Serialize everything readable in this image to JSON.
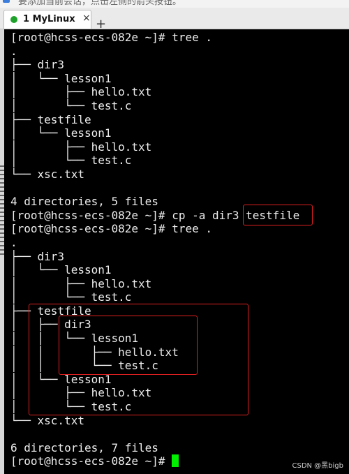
{
  "hint": {
    "text": "要添加当前会话，点击左侧的箭头按钮。"
  },
  "tabs": [
    {
      "label": "1 MyLinux",
      "close": "×",
      "status_color": "#1fa22b"
    }
  ],
  "new_tab_glyph": "+",
  "terminal": {
    "lines": [
      "[root@hcss-ecs-082e ~]# tree .",
      ".",
      "├── dir3",
      "│   └── lesson1",
      "│       ├── hello.txt",
      "│       └── test.c",
      "├── testfile",
      "│   └── lesson1",
      "│       ├── hello.txt",
      "│       └── test.c",
      "└── xsc.txt",
      "",
      "4 directories, 5 files",
      "[root@hcss-ecs-082e ~]# cp -a dir3 testfile",
      "[root@hcss-ecs-082e ~]# tree .",
      ".",
      "├── dir3",
      "│   └── lesson1",
      "│       ├── hello.txt",
      "│       └── test.c",
      "├── testfile",
      "│   ├── dir3",
      "│   │   └── lesson1",
      "│   │       ├── hello.txt",
      "│   │       └── test.c",
      "│   └── lesson1",
      "│       ├── hello.txt",
      "│       └── test.c",
      "└── xsc.txt",
      "",
      "6 directories, 7 files",
      "[root@hcss-ecs-082e ~]# "
    ],
    "text_color": "#ededed",
    "cursor_color": "#00f000",
    "highlight_color": "#e02020"
  },
  "watermark": "CSDN @黑bigb"
}
